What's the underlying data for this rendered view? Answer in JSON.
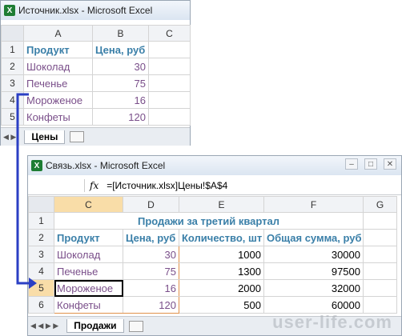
{
  "win1": {
    "title": "Источник.xlsx - Microsoft Excel",
    "columns": [
      "A",
      "B",
      "C"
    ],
    "rows": [
      {
        "n": "1",
        "a": "Продукт",
        "b": "Цена, руб"
      },
      {
        "n": "2",
        "a": "Шоколад",
        "b": "30"
      },
      {
        "n": "3",
        "a": "Печенье",
        "b": "75"
      },
      {
        "n": "4",
        "a": "Мороженое",
        "b": "16"
      },
      {
        "n": "5",
        "a": "Конфеты",
        "b": "120"
      }
    ],
    "sheet": "Цены"
  },
  "win2": {
    "title": "Связь.xlsx - Microsoft Excel",
    "fx": "fx",
    "formula": "=[Источник.xlsx]Цены!$A$4",
    "columns": [
      "C",
      "D",
      "E",
      "F",
      "G"
    ],
    "row1_title": "Продажи за третий квартал",
    "headers": [
      "Продукт",
      "Цена, руб",
      "Количество, шт",
      "Общая сумма, руб"
    ],
    "rows": [
      {
        "n": "3",
        "c": "Шоколад",
        "d": "30",
        "e": "1000",
        "f": "30000"
      },
      {
        "n": "4",
        "c": "Печенье",
        "d": "75",
        "e": "1300",
        "f": "97500"
      },
      {
        "n": "5",
        "c": "Мороженое",
        "d": "16",
        "e": "2000",
        "f": "32000"
      },
      {
        "n": "6",
        "c": "Конфеты",
        "d": "120",
        "e": "500",
        "f": "60000"
      }
    ],
    "sheet": "Продажи"
  },
  "watermark": "user-life.com",
  "colors": {
    "excel_green": "#1e7d34",
    "arrow_blue": "#2b3fc4",
    "header_blue": "#3a7fa8",
    "linked_purple": "#7a4f8a"
  }
}
